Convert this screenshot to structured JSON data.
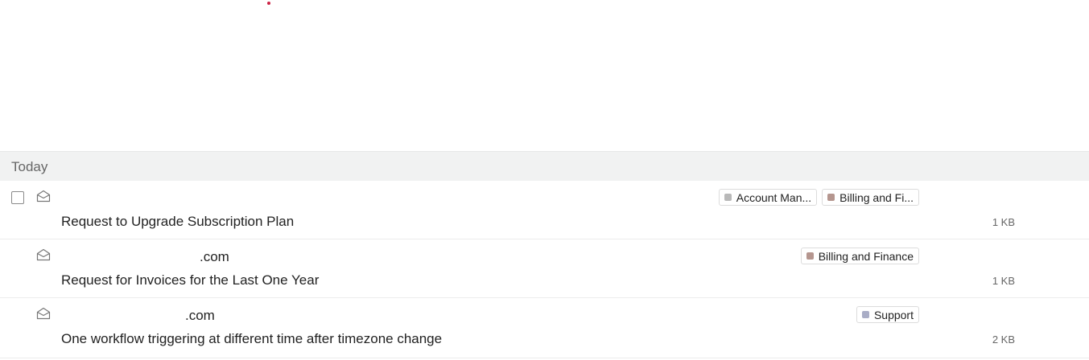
{
  "group": {
    "label": "Today"
  },
  "emails": [
    {
      "sender": "",
      "subject": "Request to Upgrade Subscription Plan",
      "size": "1 KB",
      "tags": [
        {
          "label": "Account Man...",
          "color": "#b9b9b9"
        },
        {
          "label": "Billing and Fi...",
          "color": "#b5968f"
        }
      ]
    },
    {
      "sender": ".com",
      "subject": "Request for Invoices for the Last One Year",
      "size": "1 KB",
      "tags": [
        {
          "label": "Billing and Finance",
          "color": "#b5968f"
        }
      ]
    },
    {
      "sender": ".com",
      "subject": "One workflow triggering at different time after timezone change",
      "size": "2 KB",
      "tags": [
        {
          "label": "Support",
          "color": "#a9adc6"
        }
      ]
    }
  ]
}
